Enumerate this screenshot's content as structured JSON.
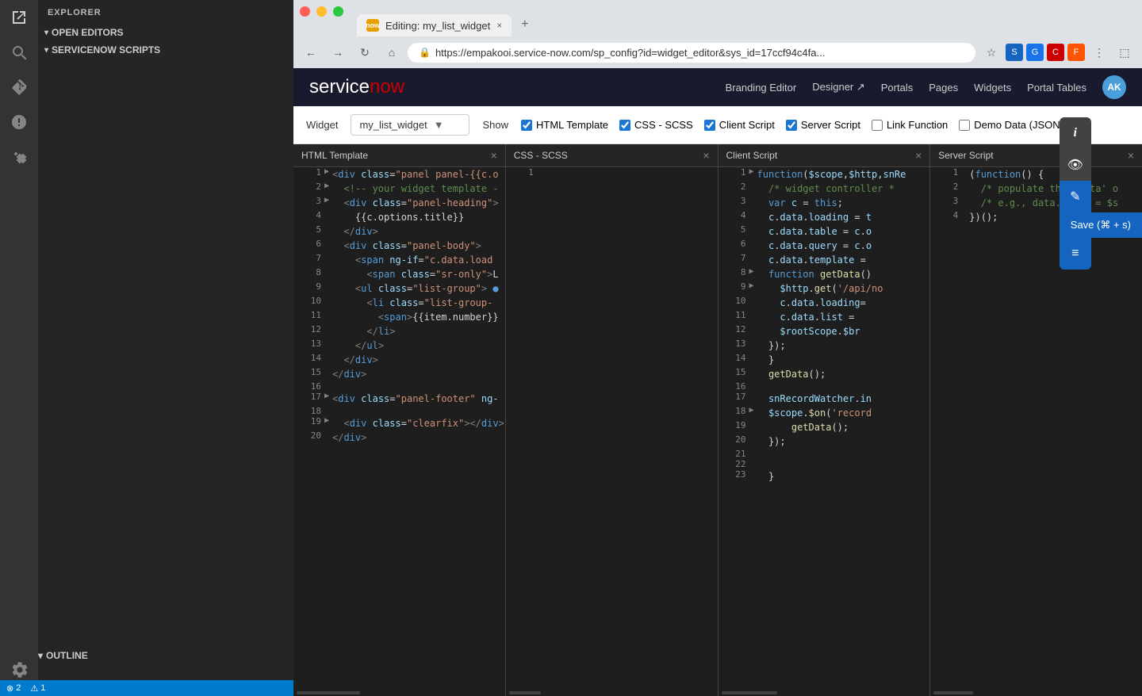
{
  "window": {
    "controls": [
      "red",
      "yellow",
      "green"
    ],
    "tab": {
      "icon_label": "now",
      "title": "Editing: my_list_widget",
      "close": "×"
    },
    "new_tab": "+"
  },
  "browser": {
    "url": "https://empakooi.service-now.com/sp_config?id=widget_editor&sys_id=17ccf94c4fa...",
    "back": "←",
    "forward": "→",
    "refresh": "↻",
    "home": "⌂"
  },
  "sn": {
    "logo_black": "service",
    "logo_red": "now",
    "nav_items": [
      "Branding Editor",
      "Designer ↗",
      "Portals",
      "Pages",
      "Widgets",
      "Portal Tables"
    ],
    "avatar": "AK"
  },
  "toolbar": {
    "widget_label": "Widget",
    "widget_name": "my_list_widget",
    "show_label": "Show",
    "checkboxes": [
      {
        "id": "html",
        "label": "HTML Template",
        "checked": true
      },
      {
        "id": "css",
        "label": "CSS - SCSS",
        "checked": true
      },
      {
        "id": "client",
        "label": "Client Script",
        "checked": true
      },
      {
        "id": "server",
        "label": "Server Script",
        "checked": true
      },
      {
        "id": "link",
        "label": "Link Function",
        "checked": false
      },
      {
        "id": "demo",
        "label": "Demo Data (JSON)",
        "checked": false
      }
    ],
    "save_label": "Save (⌘ + s)"
  },
  "floating_buttons": {
    "info": "i",
    "eye": "👁",
    "edit": "✎",
    "menu": "≡"
  },
  "editors": [
    {
      "id": "html",
      "title": "HTML Template",
      "lines": [
        {
          "num": 1,
          "arrow": "▶",
          "code": "<div class=\"panel panel-{{c.o"
        },
        {
          "num": 2,
          "arrow": "▶",
          "code": "  <!-- your widget template -"
        },
        {
          "num": 3,
          "arrow": "▶",
          "code": "  <div class=\"panel-heading\">"
        },
        {
          "num": 4,
          "arrow": "",
          "code": "    {{c.options.title}}"
        },
        {
          "num": 5,
          "arrow": "",
          "code": "  </div>"
        },
        {
          "num": 6,
          "arrow": "",
          "code": "  <div class=\"panel-body\">"
        },
        {
          "num": 7,
          "arrow": "",
          "code": "    <span ng-if=\"c.data.load"
        },
        {
          "num": 8,
          "arrow": "",
          "code": "      <span class=\"sr-only\">L"
        },
        {
          "num": 9,
          "arrow": "",
          "code": "    <ul class=\"list-group\"> ●"
        },
        {
          "num": 10,
          "arrow": "",
          "code": "      <li class=\"list-group-"
        },
        {
          "num": 11,
          "arrow": "",
          "code": "        <span>{{item.number}}"
        },
        {
          "num": 12,
          "arrow": "",
          "code": "      </li>"
        },
        {
          "num": 13,
          "arrow": "",
          "code": "    </ul>"
        },
        {
          "num": 14,
          "arrow": "",
          "code": "  </div>"
        },
        {
          "num": 15,
          "arrow": "",
          "code": "</div>"
        },
        {
          "num": 16,
          "arrow": "",
          "code": ""
        },
        {
          "num": 17,
          "arrow": "▶",
          "code": "<div class=\"panel-footer\" ng-"
        },
        {
          "num": 18,
          "arrow": "",
          "code": ""
        },
        {
          "num": 19,
          "arrow": "▶",
          "code": "  <div class=\"clearfix\"></div>"
        },
        {
          "num": 20,
          "arrow": "",
          "code": "</div>"
        }
      ]
    },
    {
      "id": "css",
      "title": "CSS - SCSS",
      "lines": [
        {
          "num": 1,
          "arrow": "",
          "code": ""
        }
      ]
    },
    {
      "id": "client",
      "title": "Client Script",
      "lines": [
        {
          "num": 1,
          "arrow": "▶",
          "code": "function($scope,$http,snRe"
        },
        {
          "num": 2,
          "arrow": "",
          "code": "  /* widget controller *"
        },
        {
          "num": 3,
          "arrow": "",
          "code": "  var c = this;"
        },
        {
          "num": 4,
          "arrow": "",
          "code": "  c.data.loading = t"
        },
        {
          "num": 5,
          "arrow": "",
          "code": "  c.data.table = c.o"
        },
        {
          "num": 6,
          "arrow": "",
          "code": "  c.data.query = c.o"
        },
        {
          "num": 7,
          "arrow": "",
          "code": "  c.data.template ="
        },
        {
          "num": 8,
          "arrow": "▶",
          "code": "  function getData()"
        },
        {
          "num": 9,
          "arrow": "▶",
          "code": "    $http.get('/api/no"
        },
        {
          "num": 10,
          "arrow": "",
          "code": "    c.data.loading="
        },
        {
          "num": 11,
          "arrow": "",
          "code": "    c.data.list ="
        },
        {
          "num": 12,
          "arrow": "",
          "code": "    $rootScope.$br"
        },
        {
          "num": 13,
          "arrow": "",
          "code": "  });"
        },
        {
          "num": 14,
          "arrow": "",
          "code": "  }"
        },
        {
          "num": 15,
          "arrow": "",
          "code": "  getData();"
        },
        {
          "num": 16,
          "arrow": "",
          "code": ""
        },
        {
          "num": 17,
          "arrow": "",
          "code": "  snRecordWatcher.in"
        },
        {
          "num": 18,
          "arrow": "▶",
          "code": "  $scope.$on('record"
        },
        {
          "num": 19,
          "arrow": "",
          "code": "      getData();"
        },
        {
          "num": 20,
          "arrow": "",
          "code": "  });"
        },
        {
          "num": 21,
          "arrow": "",
          "code": ""
        },
        {
          "num": 22,
          "arrow": "",
          "code": ""
        },
        {
          "num": 23,
          "arrow": "",
          "code": "  }"
        }
      ]
    },
    {
      "id": "server",
      "title": "Server Script",
      "lines": [
        {
          "num": 1,
          "arrow": "",
          "code": "(function() {"
        },
        {
          "num": 2,
          "arrow": "",
          "code": "  /* populate the 'data' o"
        },
        {
          "num": 3,
          "arrow": "",
          "code": "  /* e.g., data.table = $s"
        },
        {
          "num": 4,
          "arrow": "",
          "code": "})();"
        }
      ]
    }
  ],
  "sidebar": {
    "title": "EXPLORER",
    "sections": [
      {
        "id": "open-editors",
        "label": "OPEN EDITORS"
      },
      {
        "id": "servicenow-scripts",
        "label": "SERVICENOW SCRIPTS"
      }
    ],
    "outline": "OUTLINE"
  },
  "status_bar": {
    "errors": "⊗ 2",
    "warnings": "⚠ 1"
  }
}
